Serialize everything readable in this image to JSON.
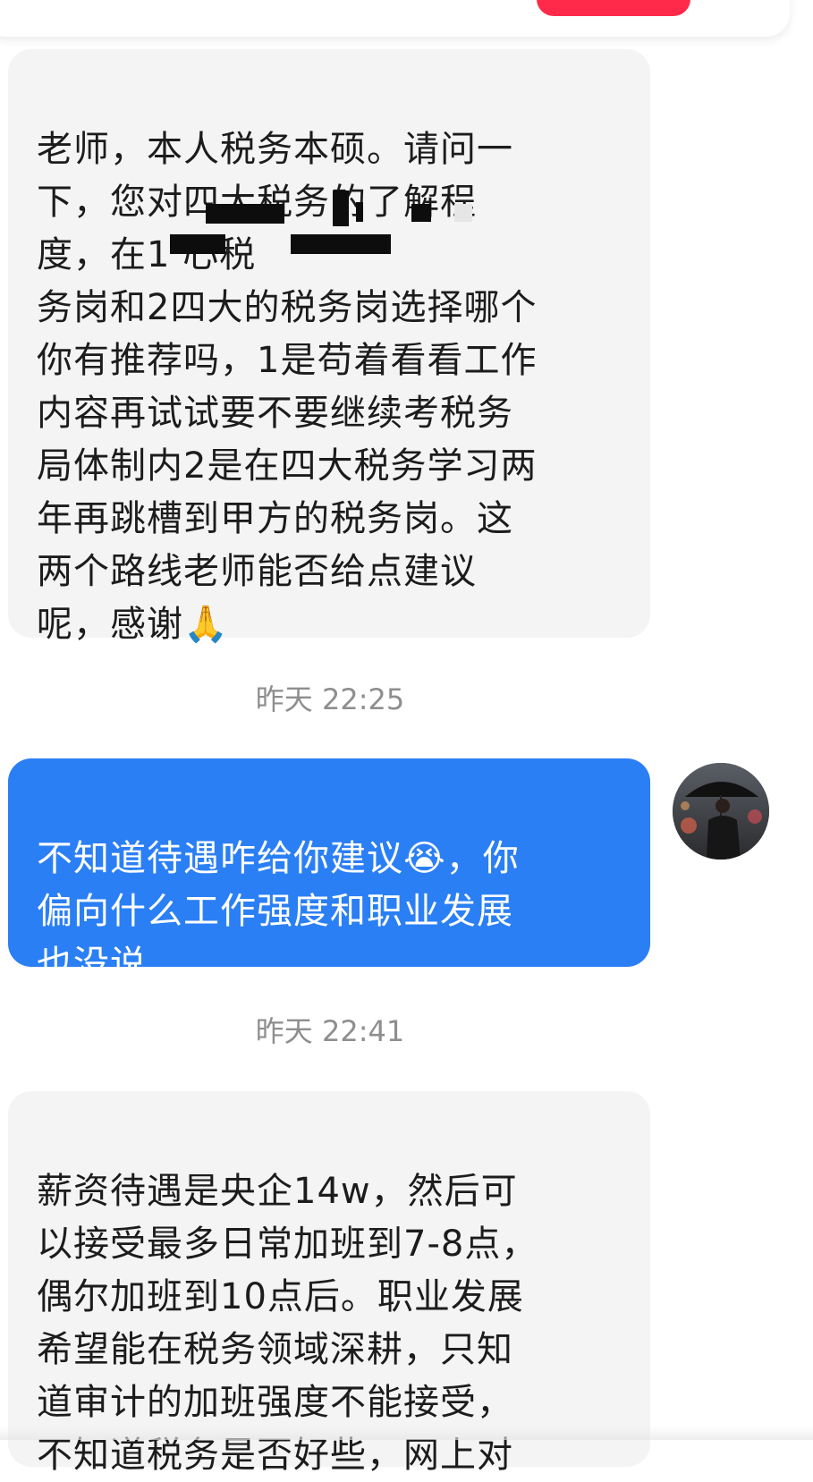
{
  "messages": [
    {
      "id": "msg1",
      "direction": "incoming",
      "text": "老师，本人税务本硕。请问一\n下，您对四大税务的了解程\n度，在1                    心税\n务岗和2四大的税务岗选择哪个\n你有推荐吗，1是苟着看看工作\n内容再试试要不要继续考税务\n局体制内2是在四大税务学习两\n年再跳槽到甲方的税务岗。这\n两个路线老师能否给点建议\n呢，感谢🙏"
    },
    {
      "id": "msg2",
      "direction": "outgoing",
      "text": "不知道待遇咋给你建议😭，你\n偏向什么工作强度和职业发展\n也没说"
    },
    {
      "id": "msg3",
      "direction": "incoming",
      "text": "薪资待遇是央企14w，然后可\n以接受最多日常加班到7-8点，\n偶尔加班到10点后。职业发展\n希望能在税务领域深耕，只知\n道审计的加班强度不能接受，\n不知道税务是否好些，网上对"
    }
  ],
  "timestamps": [
    "昨天 22:25",
    "昨天 22:41"
  ],
  "colors": {
    "incoming_bubble": "#f4f4f4",
    "outgoing_bubble": "#2b7ff5",
    "accent_pill": "#ff2a4a",
    "timestamp_text": "#8e8e8e"
  },
  "icons": {
    "avatar": "avatar-man-with-umbrella-icon",
    "emoji_pray": "folded-hands-emoji",
    "emoji_cry": "crying-face-emoji"
  }
}
